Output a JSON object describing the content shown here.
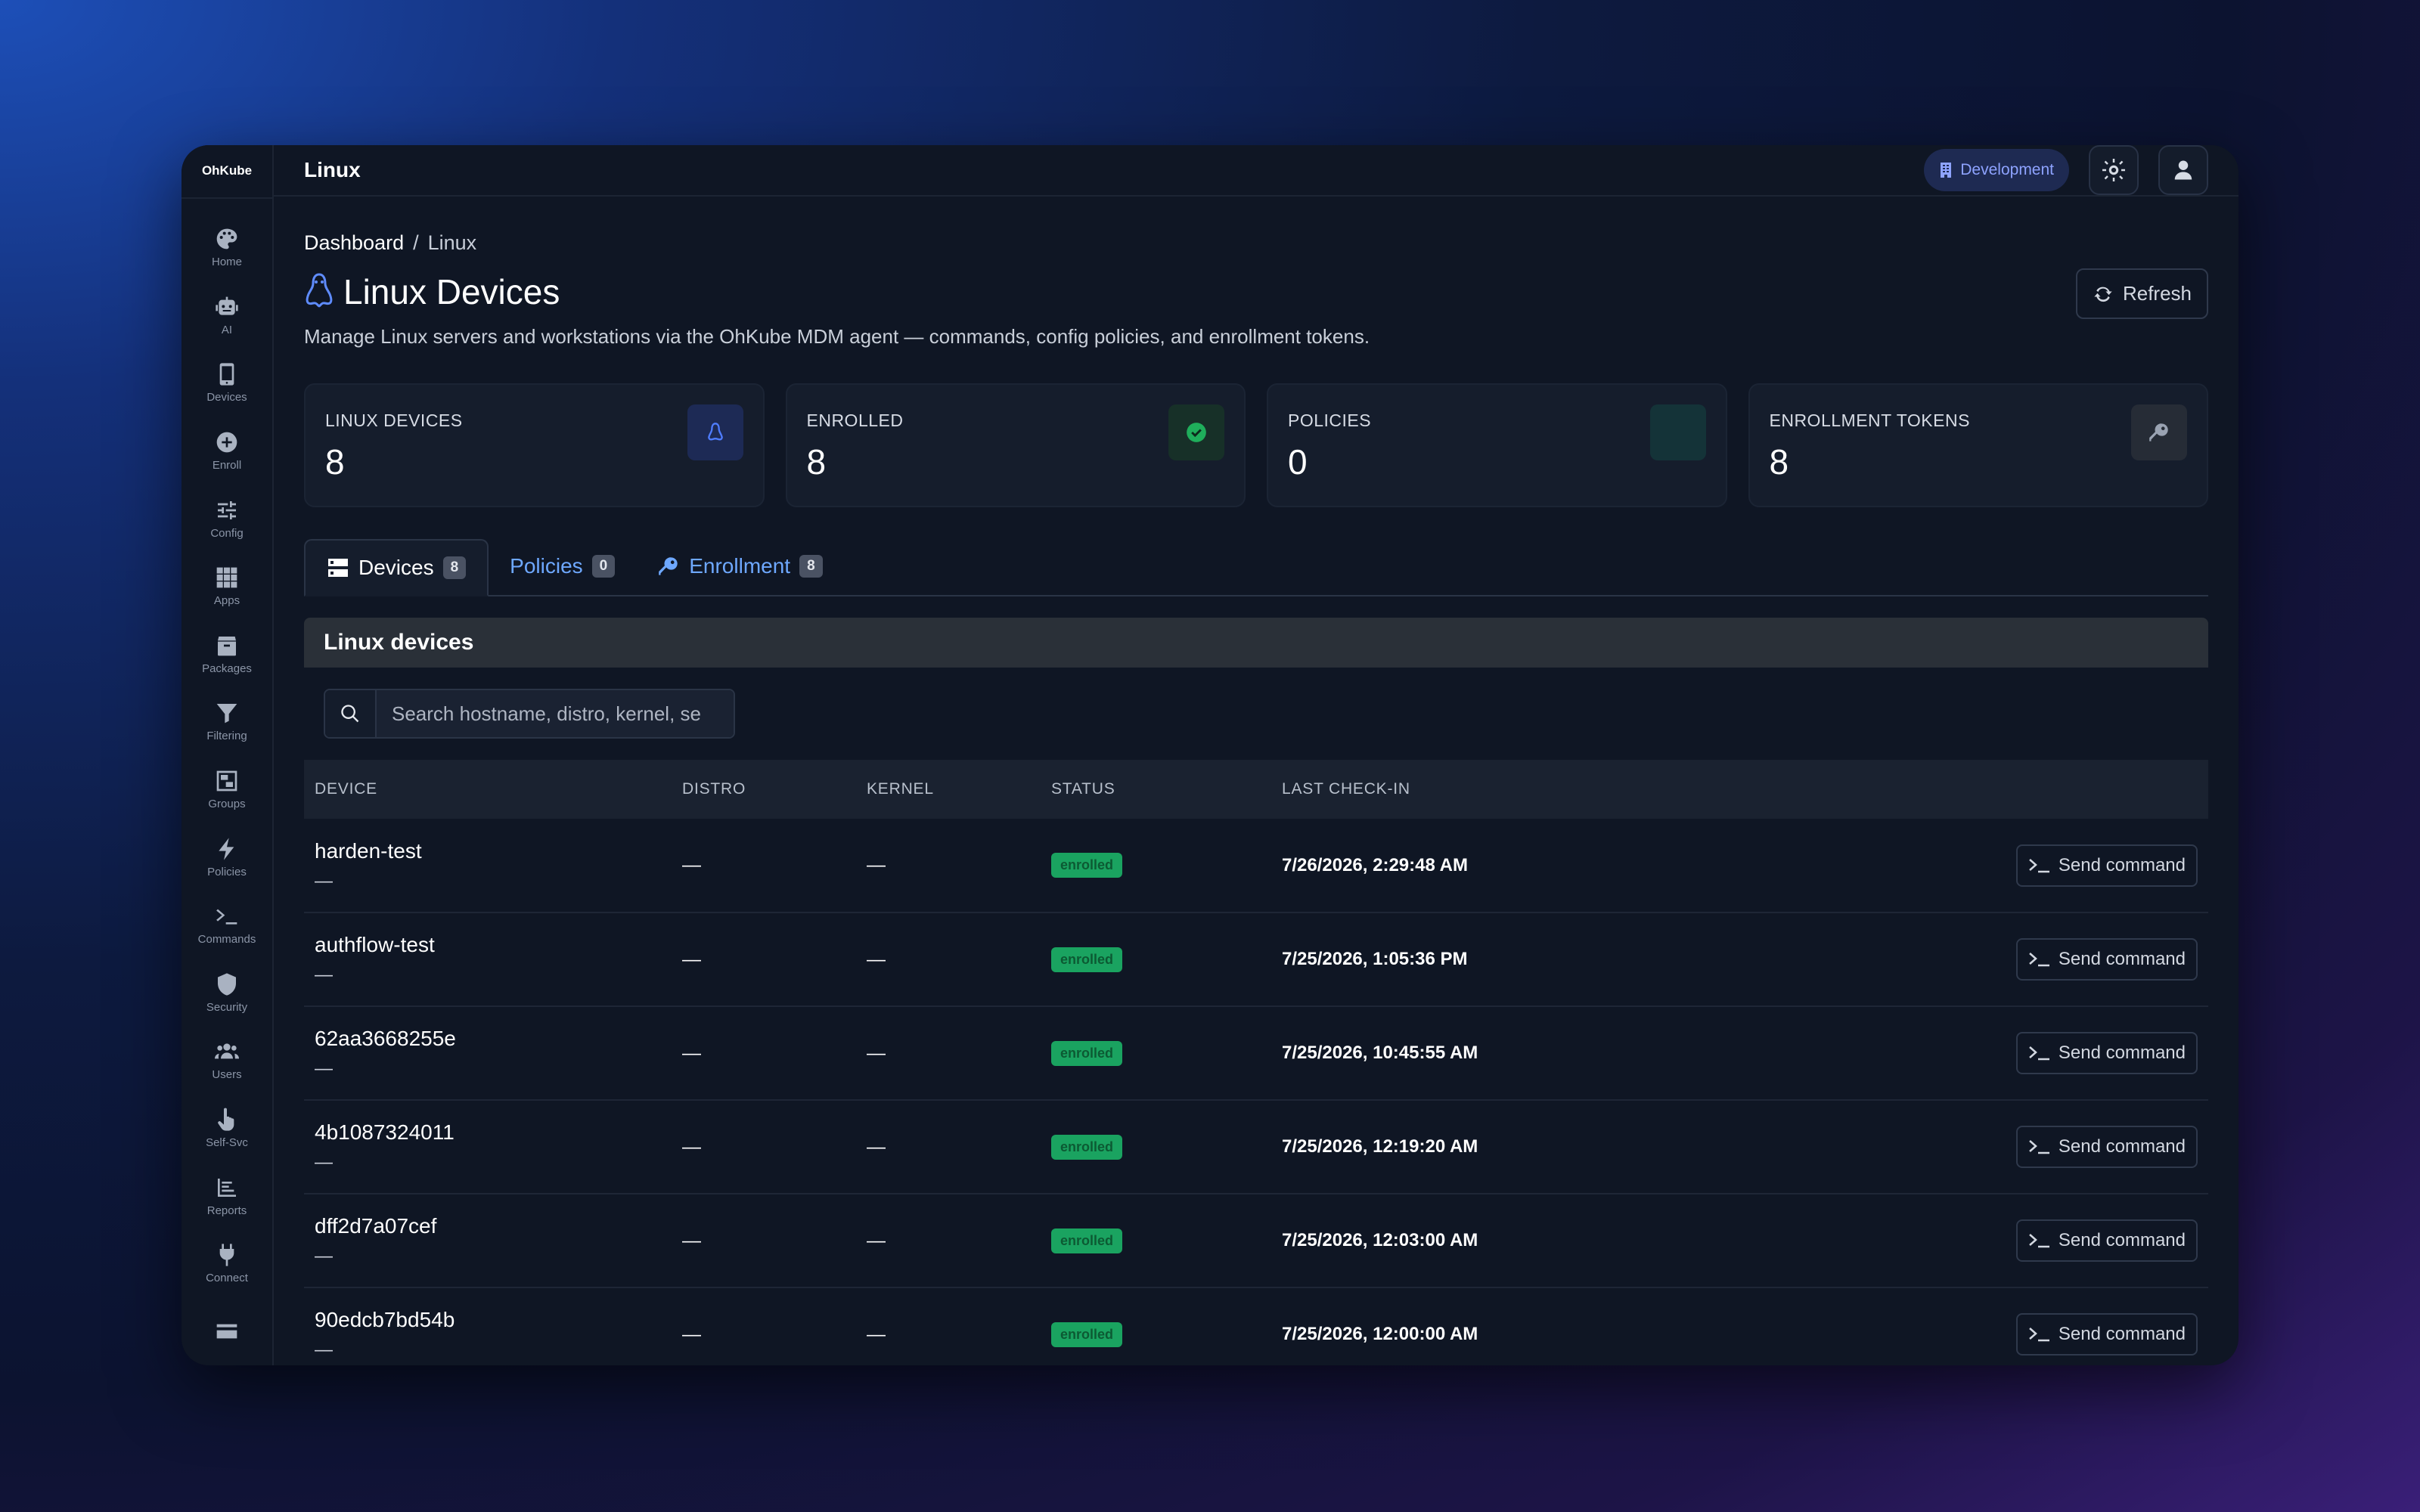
{
  "app": {
    "brand": "OhKube",
    "page_title": "Linux"
  },
  "sidebar": {
    "items": [
      {
        "label": "Home",
        "icon": "palette-icon"
      },
      {
        "label": "AI",
        "icon": "robot-icon"
      },
      {
        "label": "Devices",
        "icon": "phone-icon"
      },
      {
        "label": "Enroll",
        "icon": "plus-circle-icon"
      },
      {
        "label": "Config",
        "icon": "sliders-icon"
      },
      {
        "label": "Apps",
        "icon": "grid-icon"
      },
      {
        "label": "Packages",
        "icon": "box-icon"
      },
      {
        "label": "Filtering",
        "icon": "filter-icon"
      },
      {
        "label": "Groups",
        "icon": "object-group-icon"
      },
      {
        "label": "Policies",
        "icon": "bolt-icon"
      },
      {
        "label": "Commands",
        "icon": "terminal-icon"
      },
      {
        "label": "Security",
        "icon": "shield-icon"
      },
      {
        "label": "Users",
        "icon": "users-icon"
      },
      {
        "label": "Self-Svc",
        "icon": "hand-pointer-icon"
      },
      {
        "label": "Reports",
        "icon": "chart-icon"
      },
      {
        "label": "Connect",
        "icon": "plug-icon"
      },
      {
        "label": "",
        "icon": "card-icon"
      }
    ]
  },
  "topbar": {
    "env_label": "Development"
  },
  "breadcrumb": {
    "root": "Dashboard",
    "sep": "/",
    "current": "Linux"
  },
  "header": {
    "title": "Linux Devices",
    "subtitle": "Manage Linux servers and workstations via the OhKube MDM agent — commands, config policies, and enrollment tokens.",
    "refresh_label": "Refresh"
  },
  "stats": [
    {
      "label": "LINUX DEVICES",
      "value": "8",
      "icon": "linux-icon",
      "color": "#1d2a55"
    },
    {
      "label": "ENROLLED",
      "value": "8",
      "icon": "check-circle-icon",
      "color": "#173028"
    },
    {
      "label": "POLICIES",
      "value": "0",
      "icon": "",
      "color": "#143338"
    },
    {
      "label": "ENROLLMENT TOKENS",
      "value": "8",
      "icon": "key-icon",
      "color": "#262c36"
    }
  ],
  "tabs": [
    {
      "label": "Devices",
      "count": "8"
    },
    {
      "label": "Policies",
      "count": "0"
    },
    {
      "label": "Enrollment",
      "count": "8"
    }
  ],
  "panel": {
    "title": "Linux devices",
    "search_placeholder": "Search hostname, distro, kernel, se"
  },
  "table": {
    "columns": [
      "DEVICE",
      "DISTRO",
      "KERNEL",
      "STATUS",
      "LAST CHECK-IN",
      ""
    ],
    "action_label": "Send command",
    "rows": [
      {
        "device": "harden-test",
        "sub": "—",
        "distro": "—",
        "kernel": "—",
        "status": "enrolled",
        "checkin": "7/26/2026, 2:29:48 AM"
      },
      {
        "device": "authflow-test",
        "sub": "—",
        "distro": "—",
        "kernel": "—",
        "status": "enrolled",
        "checkin": "7/25/2026, 1:05:36 PM"
      },
      {
        "device": "62aa3668255e",
        "sub": "—",
        "distro": "—",
        "kernel": "—",
        "status": "enrolled",
        "checkin": "7/25/2026, 10:45:55 AM"
      },
      {
        "device": "4b1087324011",
        "sub": "—",
        "distro": "—",
        "kernel": "—",
        "status": "enrolled",
        "checkin": "7/25/2026, 12:19:20 AM"
      },
      {
        "device": "dff2d7a07cef",
        "sub": "—",
        "distro": "—",
        "kernel": "—",
        "status": "enrolled",
        "checkin": "7/25/2026, 12:03:00 AM"
      },
      {
        "device": "90edcb7bd54b",
        "sub": "—",
        "distro": "—",
        "kernel": "—",
        "status": "enrolled",
        "checkin": "7/25/2026, 12:00:00 AM"
      }
    ]
  }
}
